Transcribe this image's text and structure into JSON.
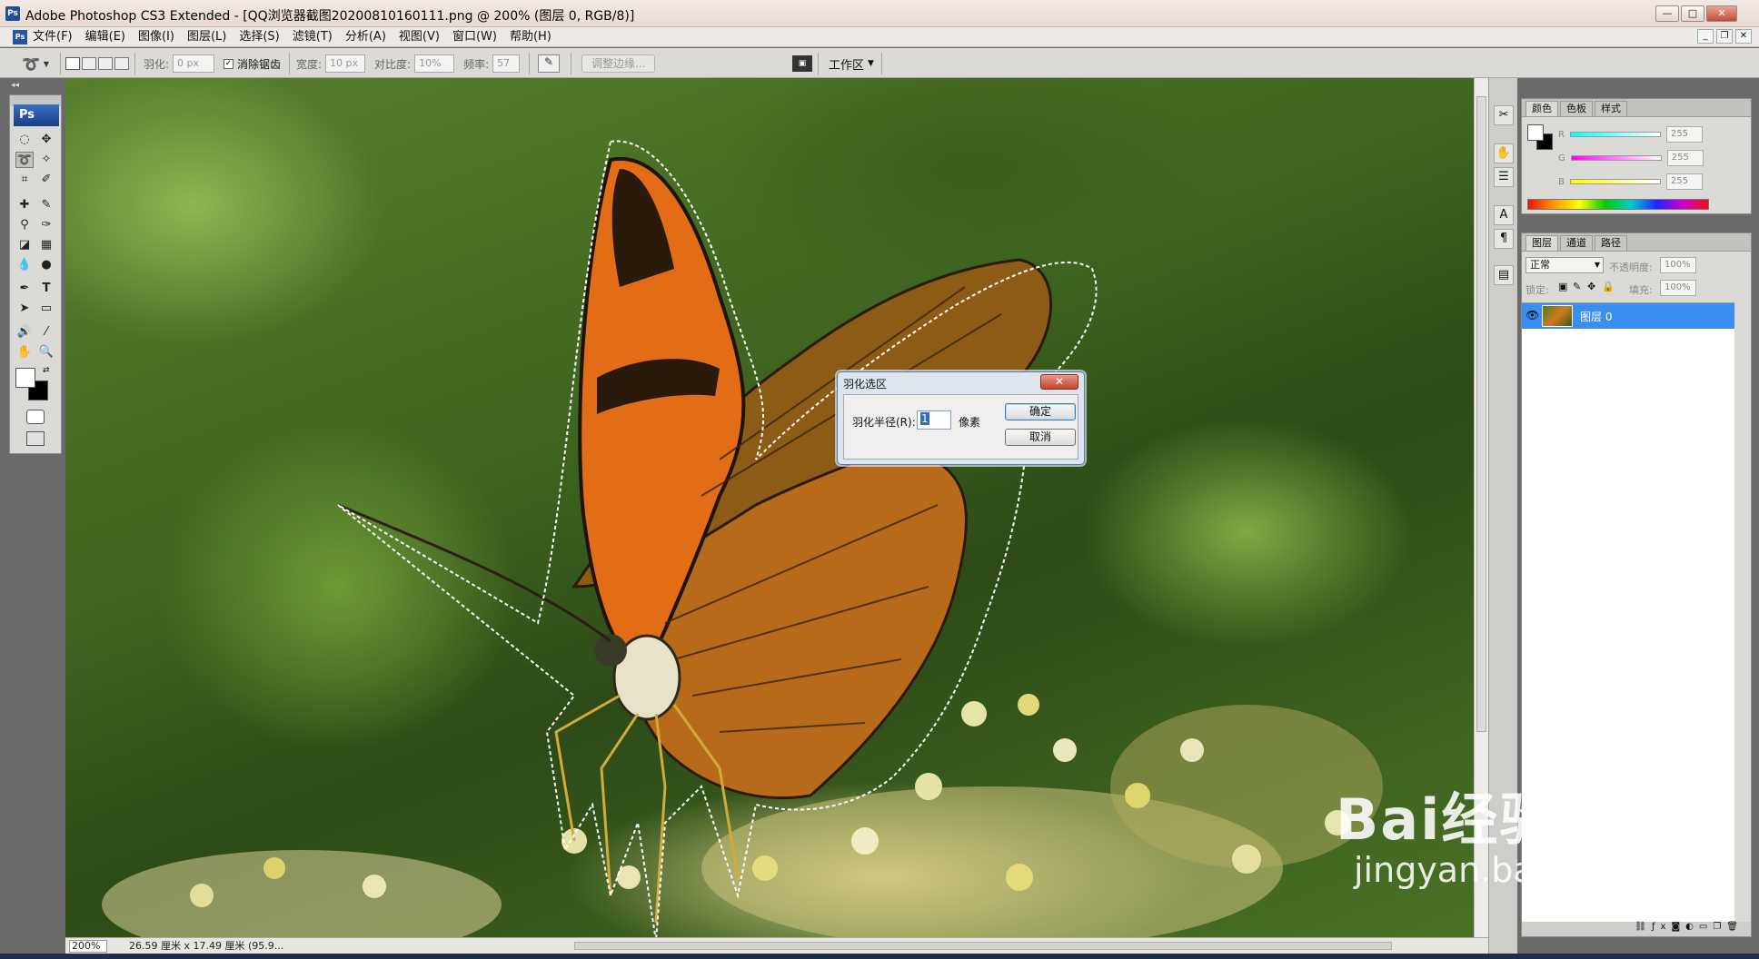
{
  "window": {
    "title": "Adobe Photoshop CS3 Extended - [QQ浏览器截图20200810160111.png @ 200% (图层 0, RGB/8)]",
    "app_icon": "Ps",
    "controls": [
      "—",
      "□",
      "✕"
    ]
  },
  "menu": {
    "app_icon": "Ps",
    "items": [
      "文件(F)",
      "编辑(E)",
      "图像(I)",
      "图层(L)",
      "选择(S)",
      "滤镜(T)",
      "分析(A)",
      "视图(V)",
      "窗口(W)",
      "帮助(H)"
    ],
    "mdi_controls": [
      "_",
      "❐",
      "✕"
    ]
  },
  "options": {
    "feather_label": "羽化:",
    "feather_value": "0 px",
    "antialias_label": "消除锯齿",
    "width_label": "宽度:",
    "width_value": "10 px",
    "contrast_label": "对比度:",
    "contrast_value": "10%",
    "frequency_label": "频率:",
    "frequency_value": "57",
    "refine_edge": "调整边缘...",
    "workspace": "工作区"
  },
  "toolbox": {
    "logo": "Ps"
  },
  "statusbar": {
    "zoom": "200%",
    "info": "26.59 厘米 x 17.49 厘米 (95.9..."
  },
  "color_panel": {
    "tabs": [
      "颜色",
      "色板",
      "样式"
    ],
    "r_label": "R",
    "g_label": "G",
    "b_label": "B",
    "r_value": "255",
    "g_value": "255",
    "b_value": "255"
  },
  "layers_panel": {
    "tabs": [
      "图层",
      "通道",
      "路径"
    ],
    "blend_mode": "正常",
    "opacity_label": "不透明度:",
    "opacity_value": "100%",
    "lock_label": "锁定:",
    "fill_label": "填充:",
    "fill_value": "100%",
    "layer_name": "图层 0"
  },
  "dialog": {
    "title": "羽化选区",
    "close": "✕",
    "radius_label": "羽化半径(R):",
    "radius_value": "1",
    "unit": "像素",
    "ok": "确定",
    "cancel": "取消"
  },
  "watermark": {
    "brand": "Bai经验",
    "url": "jingyan.baidu.com"
  },
  "colors": {
    "selection_accent": "#3a8ef0",
    "dialog_border": "#5a7aa8",
    "butterfly_orange": "#e36d16"
  }
}
